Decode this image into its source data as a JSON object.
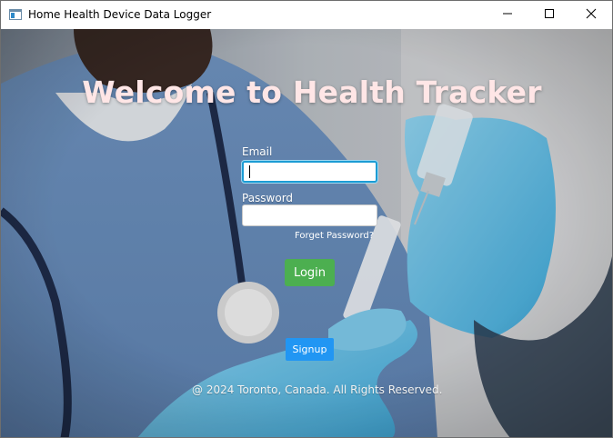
{
  "window": {
    "title": "Home Health Device Data Logger",
    "controls": [
      "minimize-icon",
      "maximize-icon",
      "close-icon"
    ]
  },
  "main": {
    "headline": "Welcome to Health Tracker",
    "email_label": "Email",
    "email_value": "",
    "password_label": "Password",
    "password_value": "",
    "forgot_link": "Forget Password?",
    "login_button": "Login",
    "signup_button": "Signup",
    "footer": "@ 2024 Toronto, Canada. All Rights Reserved."
  },
  "colors": {
    "login": "#4caf50",
    "signup": "#2196f3",
    "focus": "#1c9cd4"
  }
}
